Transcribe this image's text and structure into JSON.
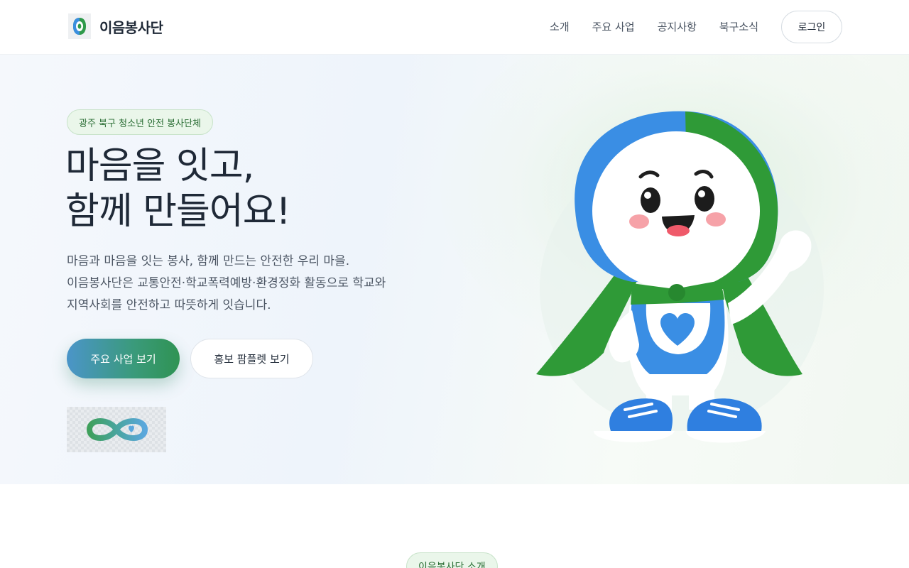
{
  "header": {
    "brand_name": "이음봉사단",
    "nav": [
      "소개",
      "주요 사업",
      "공지사항",
      "북구소식"
    ],
    "login_label": "로그인"
  },
  "hero": {
    "badge": "광주 북구 청소년 안전 봉사단체",
    "title_lines": [
      "마음을 잇고,",
      "함께 만들어요!"
    ],
    "desc_lines": [
      "마음과 마음을 잇는 봉사, 함께 만드는 안전한 우리 마을.",
      "이음봉사단은 교통안전·학교폭력예방·환경정화 활동으로 학교와",
      "지역사회를 안전하고 따뜻하게 잇습니다."
    ],
    "primary_button": "주요 사업 보기",
    "secondary_button": "홍보 팜플렛 보기",
    "mascot_icon": "mascot-illustration",
    "infinity_icon": "infinity-heart-logo"
  },
  "section": {
    "badge": "이음봉사단 소개"
  },
  "colors": {
    "accent_green": "#2f9353",
    "accent_blue": "#3b8fe0",
    "badge_bg": "#eaf6ea",
    "text_dark": "#1f2937"
  }
}
